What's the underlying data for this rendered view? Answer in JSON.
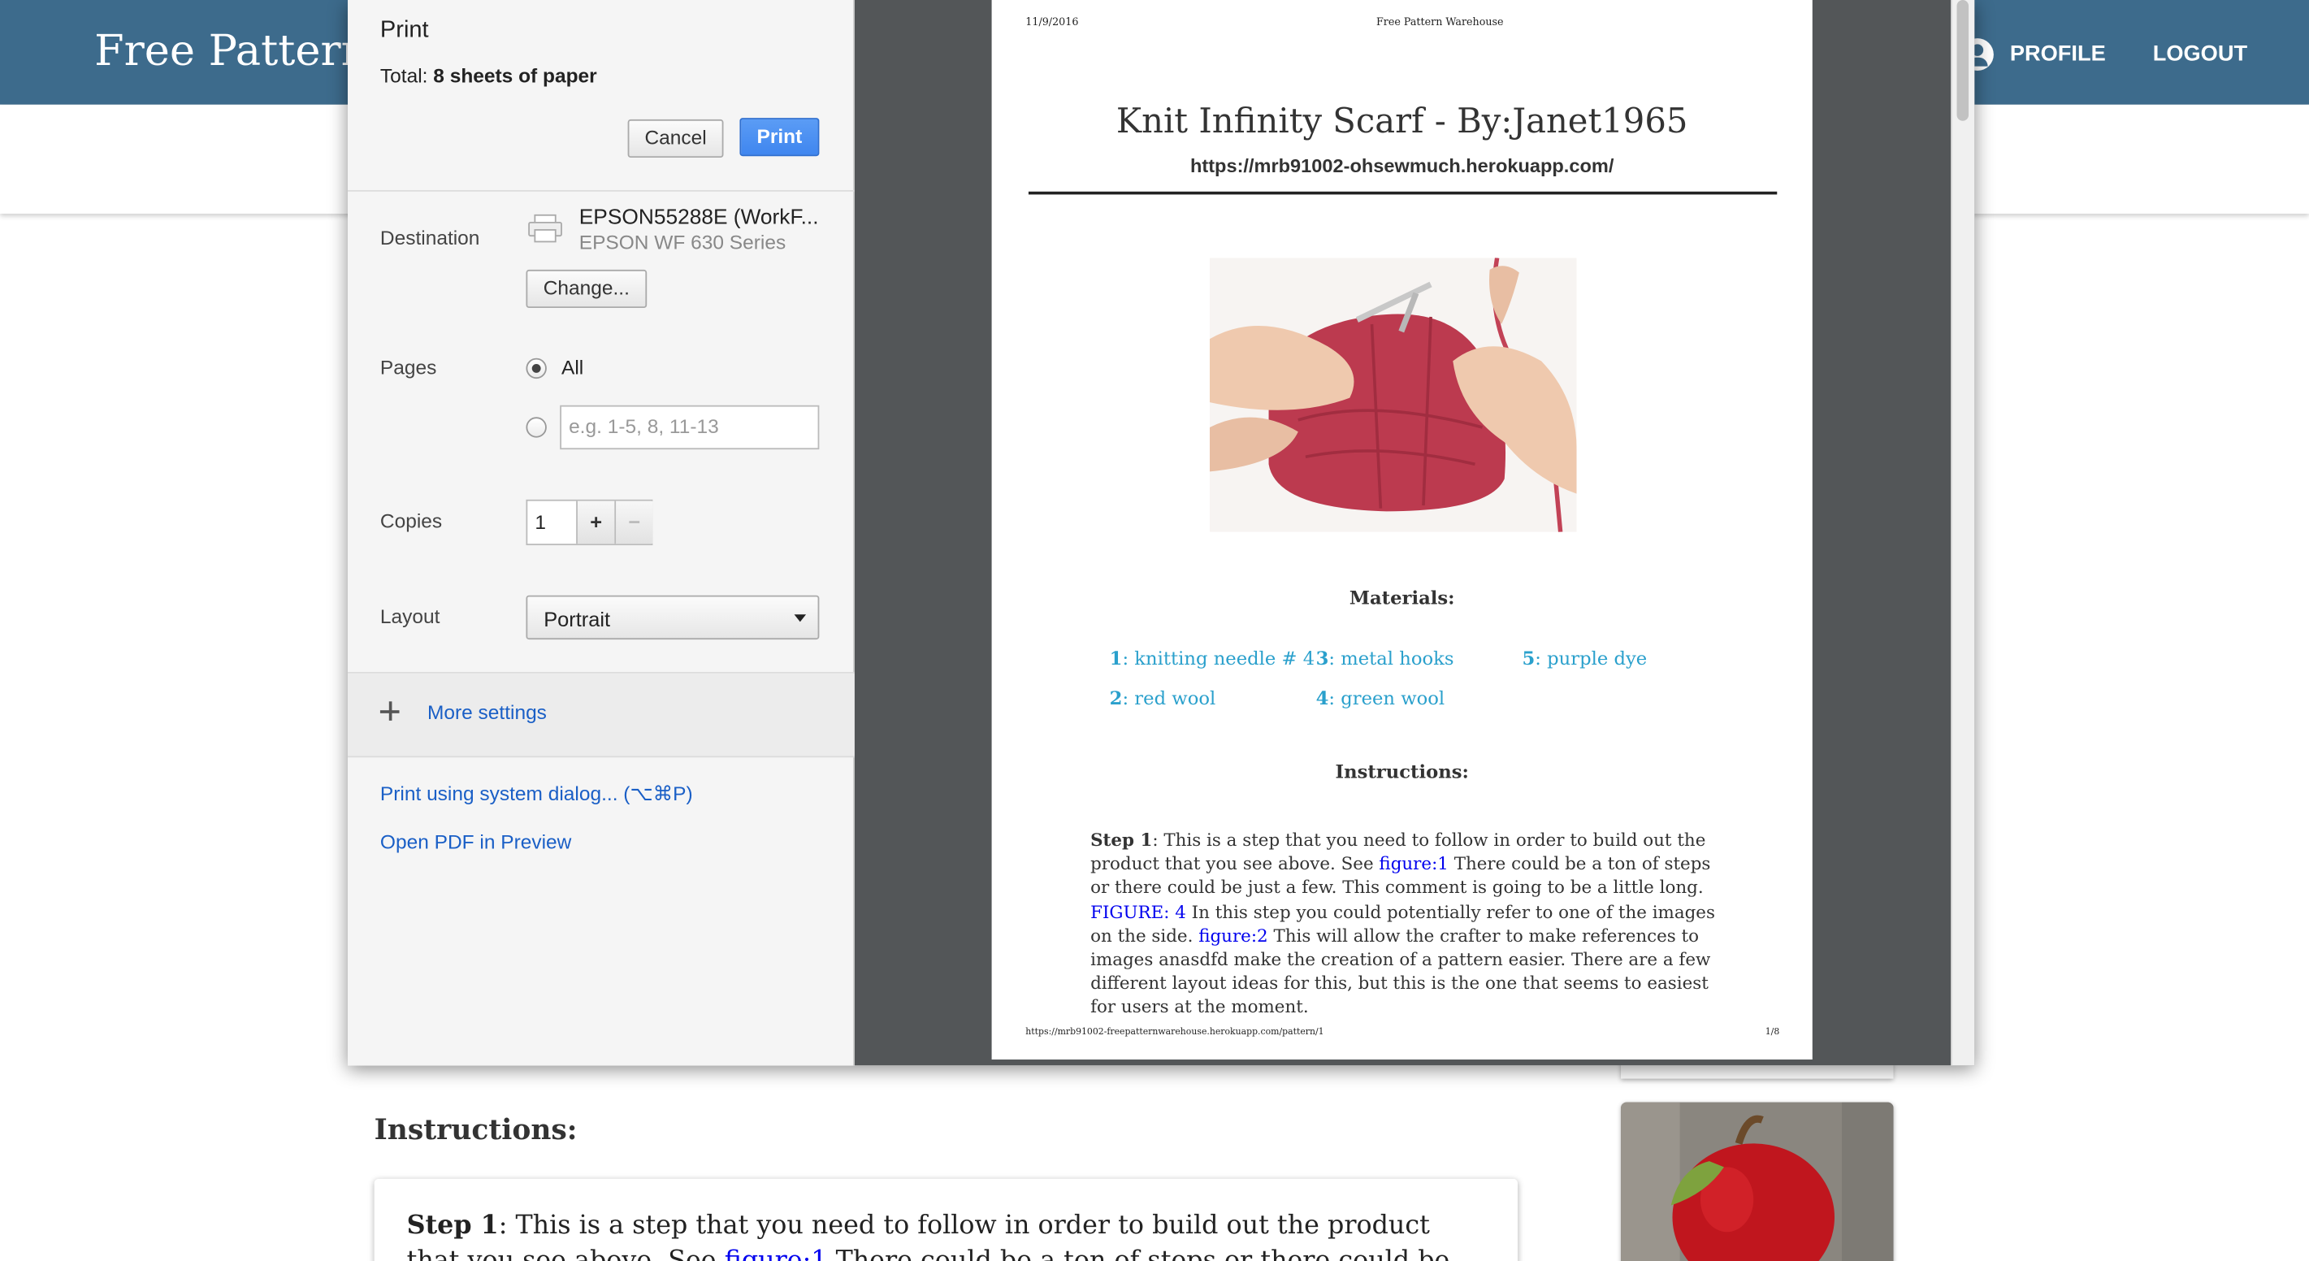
{
  "site": {
    "brand": "Free Pattern",
    "nav": {
      "profile": "PROFILE",
      "logout": "LOGOUT"
    },
    "instructions_heading": "Instructions:",
    "step_card": {
      "step_label": "Step 1",
      "text_before_link": ": This is a step that you need to follow in order to build out the product that you see above. See ",
      "link": "figure:1",
      "text_after_link": " There could be a ton of steps or there could be just a few. This"
    }
  },
  "print_dialog": {
    "title": "Print",
    "total_label": "Total:",
    "total_value": "8 sheets of paper",
    "cancel": "Cancel",
    "print": "Print",
    "destination": {
      "label": "Destination",
      "name": "EPSON55288E (WorkF...",
      "model": "EPSON WF 630 Series",
      "change": "Change..."
    },
    "pages": {
      "label": "Pages",
      "all": "All",
      "range_placeholder": "e.g. 1-5, 8, 11-13",
      "selected": "All"
    },
    "copies": {
      "label": "Copies",
      "value": "1",
      "plus": "+",
      "minus": "−"
    },
    "layout": {
      "label": "Layout",
      "value": "Portrait"
    },
    "more_settings": "More settings",
    "system_dialog": "Print using system dialog... (⌥⌘P)",
    "open_pdf": "Open PDF in Preview"
  },
  "preview": {
    "date": "11/9/2016",
    "header": "Free Pattern Warehouse",
    "title": "Knit Infinity Scarf - By:Janet1965",
    "url": "https://mrb91002-ohsewmuch.herokuapp.com/",
    "materials_heading": "Materials:",
    "materials": [
      {
        "num": "1",
        "name": "knitting needle # 4"
      },
      {
        "num": "2",
        "name": "red wool"
      },
      {
        "num": "3",
        "name": "metal hooks"
      },
      {
        "num": "4",
        "name": "green wool"
      },
      {
        "num": "5",
        "name": "purple dye"
      }
    ],
    "instructions_heading": "Instructions:",
    "step": {
      "label": "Step 1",
      "t1": ": This is a step that you need to follow in order to build out the product that you see above. See ",
      "l1": "figure:1",
      "t2": " There could be a ton of steps or there could be just a few. This comment is going to be a little long. ",
      "l2": "FIGURE: 4",
      "t3": " In this step you could potentially refer to one of the images on the side. ",
      "l3": "figure:2",
      "t4": " This will allow the crafter to make references to images anasdfd make the creation of a pattern easier. There are a few different layout ideas for this, but this is the one that seems to easiest for users at the moment."
    },
    "footer_url": "https://mrb91002-freepatternwarehouse.herokuapp.com/pattern/1",
    "page_num": "1/8"
  },
  "colors": {
    "nav": "#3d6b8c",
    "print_button": "#4a8df3",
    "link": "#1a5fc6",
    "materials": "#2aa0cc",
    "preview_bg": "#535658"
  }
}
